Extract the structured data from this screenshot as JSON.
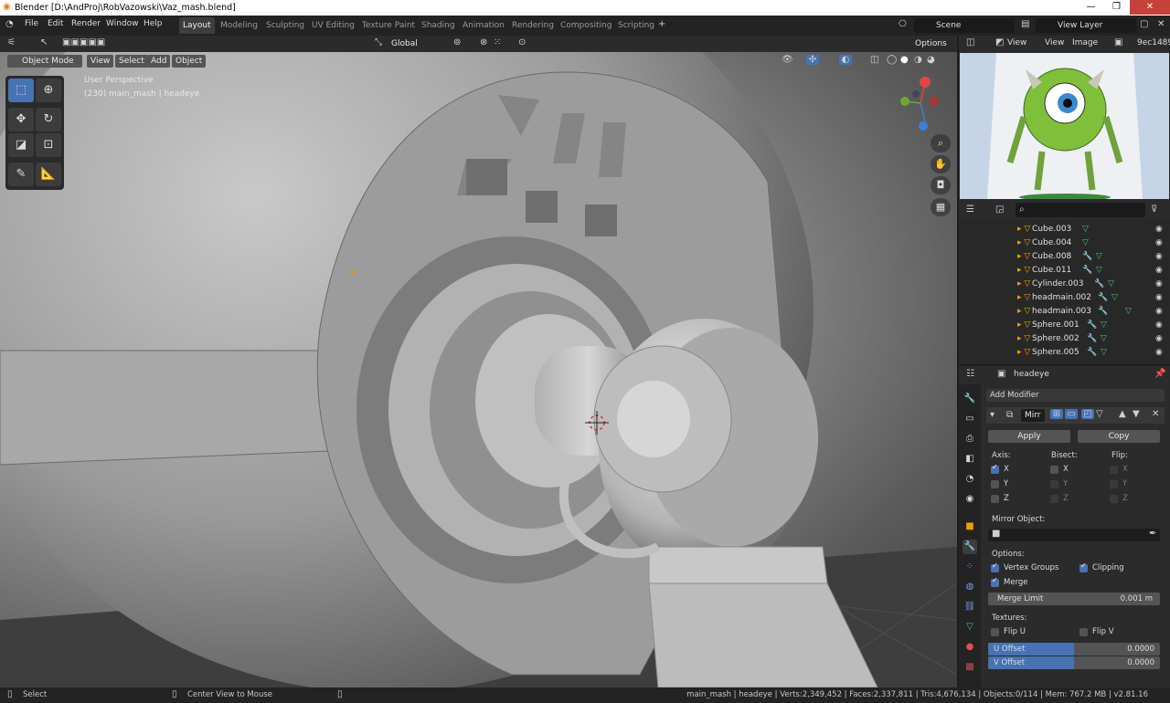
{
  "window": {
    "title": "Blender [D:\\AndProj\\RobVazowski\\Vaz_mash.blend]",
    "min": "—",
    "max": "❐",
    "close": "✕"
  },
  "menu": [
    "File",
    "Edit",
    "Render",
    "Window",
    "Help"
  ],
  "workspaces": [
    "Layout",
    "Modeling",
    "Sculpting",
    "UV Editing",
    "Texture Paint",
    "Shading",
    "Animation",
    "Rendering",
    "Compositing",
    "Scripting"
  ],
  "scene": "Scene",
  "view_layer": "View Layer",
  "header": {
    "orientation": "Global",
    "options": "Options",
    "mode": "Object Mode",
    "view": "View",
    "select": "Select",
    "add": "Add",
    "object": "Object"
  },
  "viewport": {
    "perspective": "User Perspective",
    "object_info": "(230) main_mash | headeye"
  },
  "image_editor": {
    "view": "View",
    "view2": "View",
    "image": "Image",
    "image_name": "9ec1489"
  },
  "outliner": {
    "items": [
      "Cube.003",
      "Cube.004",
      "Cube.008",
      "Cube.011",
      "Cylinder.003",
      "headmain.002",
      "headmain.003",
      "Sphere.001",
      "Sphere.002",
      "Sphere.005"
    ]
  },
  "properties": {
    "object": "headeye",
    "add_modifier": "Add Modifier",
    "mod_name": "Mirr",
    "apply": "Apply",
    "copy": "Copy",
    "axis": "Axis:",
    "bisect": "Bisect:",
    "flip": "Flip:",
    "x": "X",
    "y": "Y",
    "z": "Z",
    "mirror_object": "Mirror Object:",
    "options": "Options:",
    "vertex_groups": "Vertex Groups",
    "clipping": "Clipping",
    "merge": "Merge",
    "merge_limit": "Merge Limit",
    "merge_limit_val": "0.001 m",
    "textures": "Textures:",
    "flip_u": "Flip U",
    "flip_v": "Flip V",
    "u_offset": "U Offset",
    "u_offset_val": "0.0000",
    "v_offset": "V Offset",
    "v_offset_val": "0.0000"
  },
  "status": {
    "select": "Select",
    "center": "Center View to Mouse",
    "stats": "main_mash | headeye | Verts:2,349,452 | Faces:2,337,811 | Tris:4,676,134 | Objects:0/114 | Mem: 767.2 MB | v2.81.16"
  }
}
